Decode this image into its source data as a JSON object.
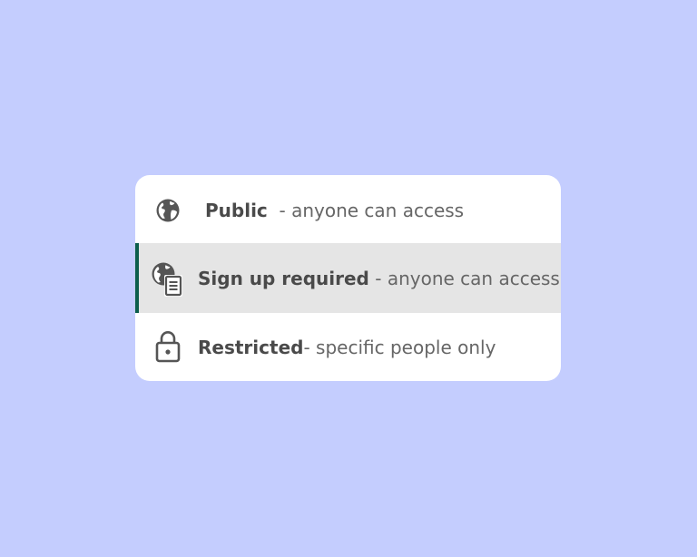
{
  "colors": {
    "background": "#c4cdfe",
    "panel": "#ffffff",
    "selected_row": "#e5e5e5",
    "selected_accent": "#0d5e4c",
    "icon": "#555555"
  },
  "options": [
    {
      "title": "Public",
      "separator": "-",
      "description": "anyone can access",
      "icon": "globe-icon",
      "selected": false
    },
    {
      "title": "Sign up required",
      "separator": "-",
      "description": "anyone can access",
      "icon": "globe-document-icon",
      "selected": true
    },
    {
      "title": "Restricted",
      "separator": "-",
      "description": "specific people only",
      "icon": "lock-icon",
      "selected": false
    }
  ]
}
